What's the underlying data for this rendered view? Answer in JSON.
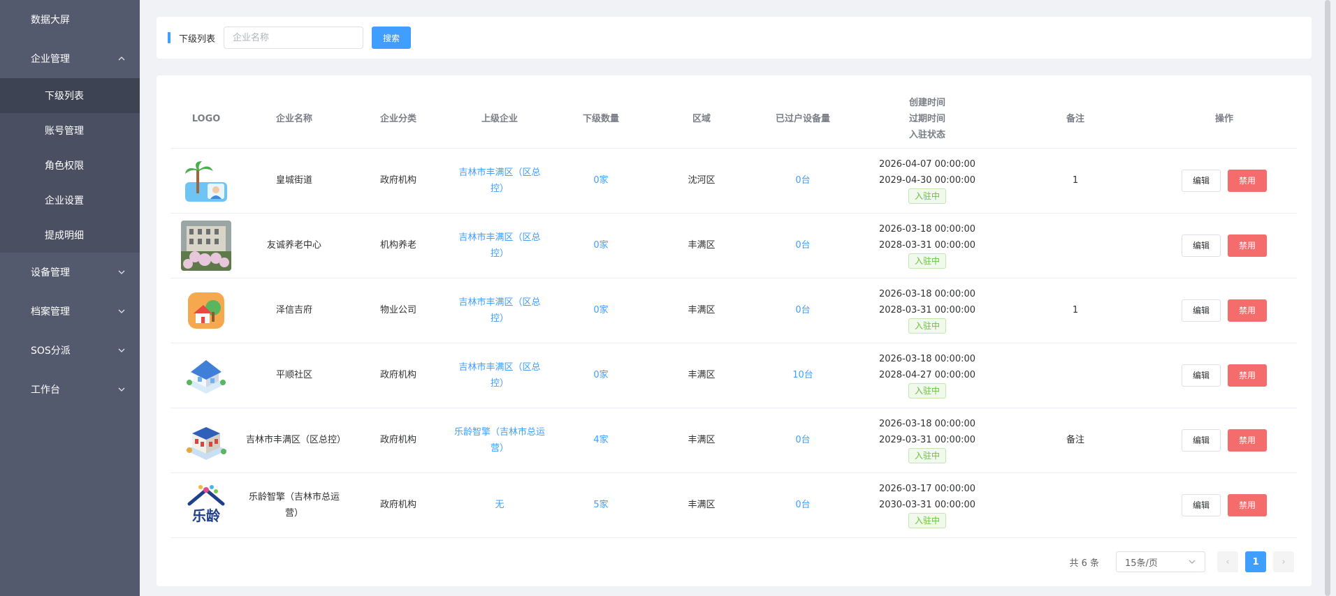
{
  "sidebar": {
    "items": [
      {
        "label": "数据大屏"
      },
      {
        "label": "企业管理"
      },
      {
        "label": "设备管理"
      },
      {
        "label": "档案管理"
      },
      {
        "label": "SOS分派"
      },
      {
        "label": "工作台"
      }
    ],
    "sub_items": [
      {
        "label": "下级列表"
      },
      {
        "label": "账号管理"
      },
      {
        "label": "角色权限"
      },
      {
        "label": "企业设置"
      },
      {
        "label": "提成明细"
      }
    ]
  },
  "search": {
    "label": "下级列表",
    "placeholder": "企业名称",
    "button": "搜索"
  },
  "table": {
    "headers": {
      "logo": "LOGO",
      "name": "企业名称",
      "category": "企业分类",
      "parent": "上级企业",
      "sub_count": "下级数量",
      "region": "区域",
      "devices": "已过户设备量",
      "time_line1": "创建时间",
      "time_line2": "过期时间",
      "time_line3": "入驻状态",
      "remark": "备注",
      "actions": "操作"
    },
    "edit_label": "编辑",
    "disable_label": "禁用",
    "rows": [
      {
        "logo": "palm-tree-logo",
        "name": "皇城街道",
        "category": "政府机构",
        "parent": "吉林市丰满区（区总控）",
        "sub_count": "0家",
        "region": "沈河区",
        "devices": "0台",
        "created": "2026-04-07 00:00:00",
        "expires": "2029-04-30 00:00:00",
        "status": "入驻中",
        "remark": "1"
      },
      {
        "logo": "building-photo-logo",
        "name": "友诚养老中心",
        "category": "机构养老",
        "parent": "吉林市丰满区（区总控）",
        "sub_count": "0家",
        "region": "丰满区",
        "devices": "0台",
        "created": "2026-03-18 00:00:00",
        "expires": "2028-03-31 00:00:00",
        "status": "入驻中",
        "remark": ""
      },
      {
        "logo": "house-tree-logo",
        "name": "泽信吉府",
        "category": "物业公司",
        "parent": "吉林市丰满区（区总控）",
        "sub_count": "0家",
        "region": "丰满区",
        "devices": "0台",
        "created": "2026-03-18 00:00:00",
        "expires": "2028-03-31 00:00:00",
        "status": "入驻中",
        "remark": "1"
      },
      {
        "logo": "isometric-house-logo",
        "name": "平顺社区",
        "category": "政府机构",
        "parent": "吉林市丰满区（区总控）",
        "sub_count": "0家",
        "region": "丰满区",
        "devices": "10台",
        "created": "2026-03-18 00:00:00",
        "expires": "2028-04-27 00:00:00",
        "status": "入驻中",
        "remark": ""
      },
      {
        "logo": "isometric-building-logo",
        "name": "吉林市丰满区（区总控）",
        "category": "政府机构",
        "parent": "乐龄智擎（吉林市总运营）",
        "sub_count": "4家",
        "region": "丰满区",
        "devices": "0台",
        "created": "2026-03-18 00:00:00",
        "expires": "2029-03-31 00:00:00",
        "status": "入驻中",
        "remark": "备注"
      },
      {
        "logo": "leling-logo",
        "name": "乐龄智擎（吉林市总运营）",
        "category": "政府机构",
        "parent": "无",
        "sub_count": "5家",
        "region": "丰满区",
        "devices": "0台",
        "created": "2026-03-17 00:00:00",
        "expires": "2030-03-31 00:00:00",
        "status": "入驻中",
        "remark": ""
      }
    ]
  },
  "logo_text": {
    "leling": "乐龄"
  },
  "pager": {
    "total": "共 6 条",
    "page_size": "15条/页",
    "current_page": "1",
    "prev": "‹",
    "next": "›"
  }
}
